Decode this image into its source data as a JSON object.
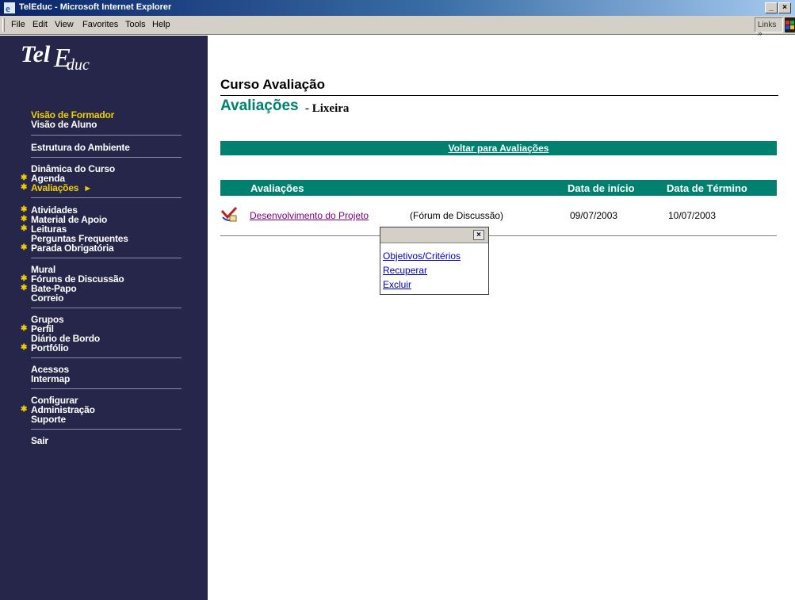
{
  "window": {
    "title": "TelEduc - Microsoft Internet Explorer",
    "minimize": "_",
    "maximize": "×"
  },
  "menubar": {
    "items": [
      "File",
      "Edit",
      "View",
      "Favorites",
      "Tools",
      "Help"
    ],
    "links_label": "Links »"
  },
  "sidebar": {
    "logo_text": "TelEduc",
    "view_formador": "Visão de Formador",
    "view_aluno": "Visão de Aluno",
    "estrutura": "Estrutura do Ambiente",
    "dinamica": "Dinâmica do Curso",
    "agenda": "Agenda",
    "avaliacoes": "Avaliações",
    "atividades": "Atividades",
    "material": "Material de Apoio",
    "leituras": "Leituras",
    "perguntas": "Perguntas Frequentes",
    "parada": "Parada Obrigatória",
    "mural": "Mural",
    "foruns": "Fóruns de Discussão",
    "batepapo": "Bate-Papo",
    "correio": "Correio",
    "grupos": "Grupos",
    "perfil": "Perfil",
    "diario": "Diário de Bordo",
    "portfolio": "Portfólio",
    "acessos": "Acessos",
    "intermap": "Intermap",
    "configurar": "Configurar",
    "administracao": "Administração",
    "suporte": "Suporte",
    "sair": "Sair"
  },
  "main": {
    "course_title": "Curso Avaliação",
    "section_title": "Avaliações",
    "section_sub": "- Lixeira",
    "back_link": "Voltar para Avaliações",
    "table": {
      "headers": [
        "Avaliações",
        "Data de início",
        "Data de Término"
      ],
      "row": {
        "name": "Desenvolvimento do Projeto",
        "type": "(Fórum de Discussão)",
        "start": "09/07/2003",
        "end": "10/07/2003"
      }
    },
    "popup": {
      "close": "×",
      "items": [
        "Objetivos/Critérios",
        "Recuperar",
        "Excluir"
      ]
    }
  },
  "colors": {
    "accent_teal": "#00806e",
    "sidebar_bg": "#26264a",
    "highlight_yellow": "#f0d000"
  }
}
